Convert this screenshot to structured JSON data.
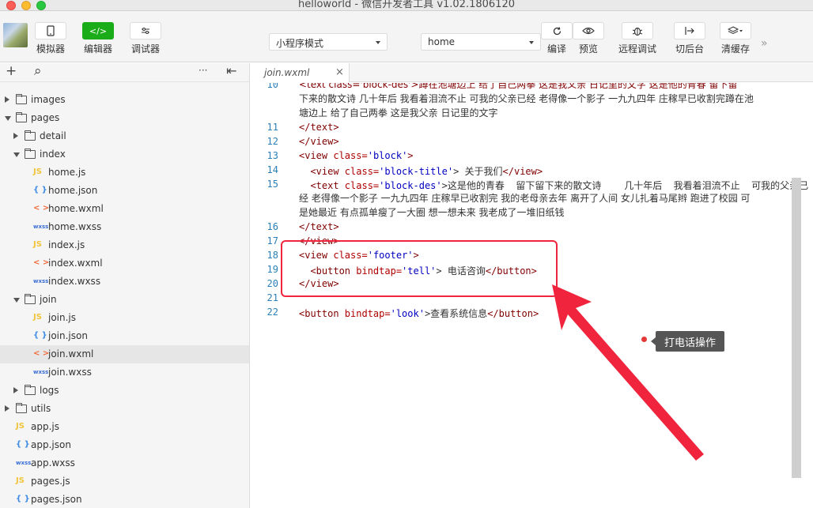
{
  "window": {
    "title": "helloworld - 微信开发者工具 v1.02.1806120"
  },
  "toolbar": {
    "simulator": "模拟器",
    "editor": "编辑器",
    "debugger": "调试器",
    "mode": "小程序模式",
    "page": "home",
    "compile": "编译",
    "preview": "预览",
    "remote_debug": "远程调试",
    "background": "切后台",
    "clear_cache": "清缓存"
  },
  "tab": {
    "name": "join.wxml"
  },
  "tree": [
    {
      "name": "images",
      "kind": "folder",
      "state": "collapsed",
      "depth": 0
    },
    {
      "name": "pages",
      "kind": "folder",
      "state": "expanded",
      "depth": 0
    },
    {
      "name": "detail",
      "kind": "folder",
      "state": "collapsed",
      "depth": 1
    },
    {
      "name": "index",
      "kind": "folder",
      "state": "expanded",
      "depth": 1
    },
    {
      "name": "home.js",
      "kind": "js",
      "depth": 2
    },
    {
      "name": "home.json",
      "kind": "json",
      "depth": 2
    },
    {
      "name": "home.wxml",
      "kind": "wxml",
      "depth": 2
    },
    {
      "name": "home.wxss",
      "kind": "wxss",
      "depth": 2
    },
    {
      "name": "index.js",
      "kind": "js",
      "depth": 2
    },
    {
      "name": "index.wxml",
      "kind": "wxml",
      "depth": 2
    },
    {
      "name": "index.wxss",
      "kind": "wxss",
      "depth": 2
    },
    {
      "name": "join",
      "kind": "folder",
      "state": "expanded",
      "depth": 1
    },
    {
      "name": "join.js",
      "kind": "js",
      "depth": 2
    },
    {
      "name": "join.json",
      "kind": "json",
      "depth": 2
    },
    {
      "name": "join.wxml",
      "kind": "wxml",
      "depth": 2,
      "selected": true
    },
    {
      "name": "join.wxss",
      "kind": "wxss",
      "depth": 2
    },
    {
      "name": "logs",
      "kind": "folder",
      "state": "collapsed",
      "depth": 1
    },
    {
      "name": "utils",
      "kind": "folder",
      "state": "collapsed",
      "depth": 0
    },
    {
      "name": "app.js",
      "kind": "js",
      "depth": 0
    },
    {
      "name": "app.json",
      "kind": "json",
      "depth": 0
    },
    {
      "name": "app.wxss",
      "kind": "wxss",
      "depth": 0
    },
    {
      "name": "pages.js",
      "kind": "js",
      "depth": 0
    },
    {
      "name": "pages.json",
      "kind": "json",
      "depth": 0
    }
  ],
  "icons": {
    "js": "JS",
    "json": "{ }",
    "wxml": "< >",
    "wxss": "wxss",
    "add": "+",
    "search": "⌕",
    "more": "···",
    "collapse": "⇤",
    "close": "×",
    "overflow": "»"
  },
  "code": {
    "line10_top": "  <text class='block-des'>蹲在池塘边上  给了自己两拳   这是我父亲 日记里的文字  这是他的青春  留下留",
    "line10_a": "下来的散文诗    几十年后  我看着泪流不止  可我的父亲已经  老得像一个影子    一九九四年  庄稼早已收割完蹲在池",
    "line10_b": "塘边上  给了自己两拳    这是我父亲  日记里的文字",
    "ln10": "10",
    "ln11": "11",
    "l11": "</text>",
    "ln12": "12",
    "l12": "</view>",
    "ln13": "13",
    "l13_tag": "<view ",
    "l13_attr": "class=",
    "l13_str": "'block'",
    "l13_end": ">",
    "ln14": "14",
    "l14_tag": "  <view ",
    "l14_attr": "class=",
    "l14_str": "'block-title'",
    "l14_text": "> 关于我们",
    "l14_end": "</view>",
    "ln15": "15",
    "l15_tag": "  <text ",
    "l15_attr": "class=",
    "l15_str": "'block-des'",
    "l15_text": ">这是他的青春  留下留下来的散文诗    几十年后  我看着泪流不止  可我的父亲已",
    "l15_b": "经  老得像一个影子    一九九四年  庄稼早已收割完  我的老母亲去年  离开了人间    女儿扎着马尾辫  跑进了校园  可",
    "l15_c": "是她最近  有点孤单瘦了一大圈    想一想未来  我老成了一堆旧纸钱",
    "ln16": "16",
    "l16": "</text>",
    "ln17": "17",
    "l17": "</view>",
    "ln18": "18",
    "l18_tag": "<view ",
    "l18_attr": "class=",
    "l18_str": "'footer'",
    "l18_end": ">",
    "ln19": "19",
    "l19_tag": "  <button ",
    "l19_attr": "bindtap=",
    "l19_str": "'tell'",
    "l19_text": "> 电话咨询",
    "l19_end": "</button>",
    "ln20": "20",
    "l20": "</view>",
    "ln21": "21",
    "ln22": "22",
    "l22_tag": "<button ",
    "l22_attr": "bindtap=",
    "l22_str": "'look'",
    "l22_text": ">查看系统信息",
    "l22_end": "</button>"
  },
  "annotation": {
    "tooltip": "打电话操作",
    "color": "#f0243c"
  }
}
